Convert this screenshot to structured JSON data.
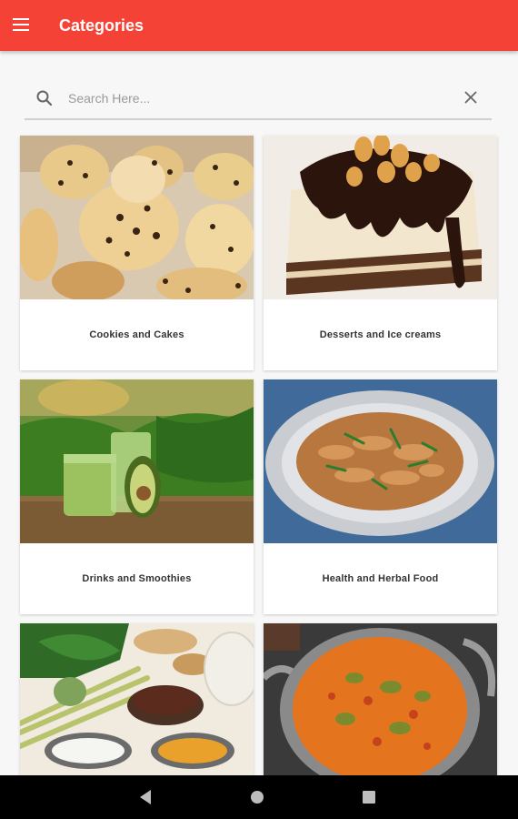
{
  "appbar": {
    "title": "Categories",
    "menu_icon": "hamburger-menu-icon",
    "color": "#f44336"
  },
  "search": {
    "placeholder": "Search Here...",
    "value": "",
    "search_icon": "search-icon",
    "clear_icon": "close-icon"
  },
  "categories": [
    {
      "label": "Cookies and Cakes"
    },
    {
      "label": "Desserts and Ice creams"
    },
    {
      "label": "Drinks and Smoothies"
    },
    {
      "label": "Health and Herbal Food"
    },
    {
      "label": ""
    },
    {
      "label": ""
    }
  ],
  "navbar": {
    "back_icon": "back-triangle-icon",
    "home_icon": "home-circle-icon",
    "recents_icon": "recents-square-icon"
  }
}
